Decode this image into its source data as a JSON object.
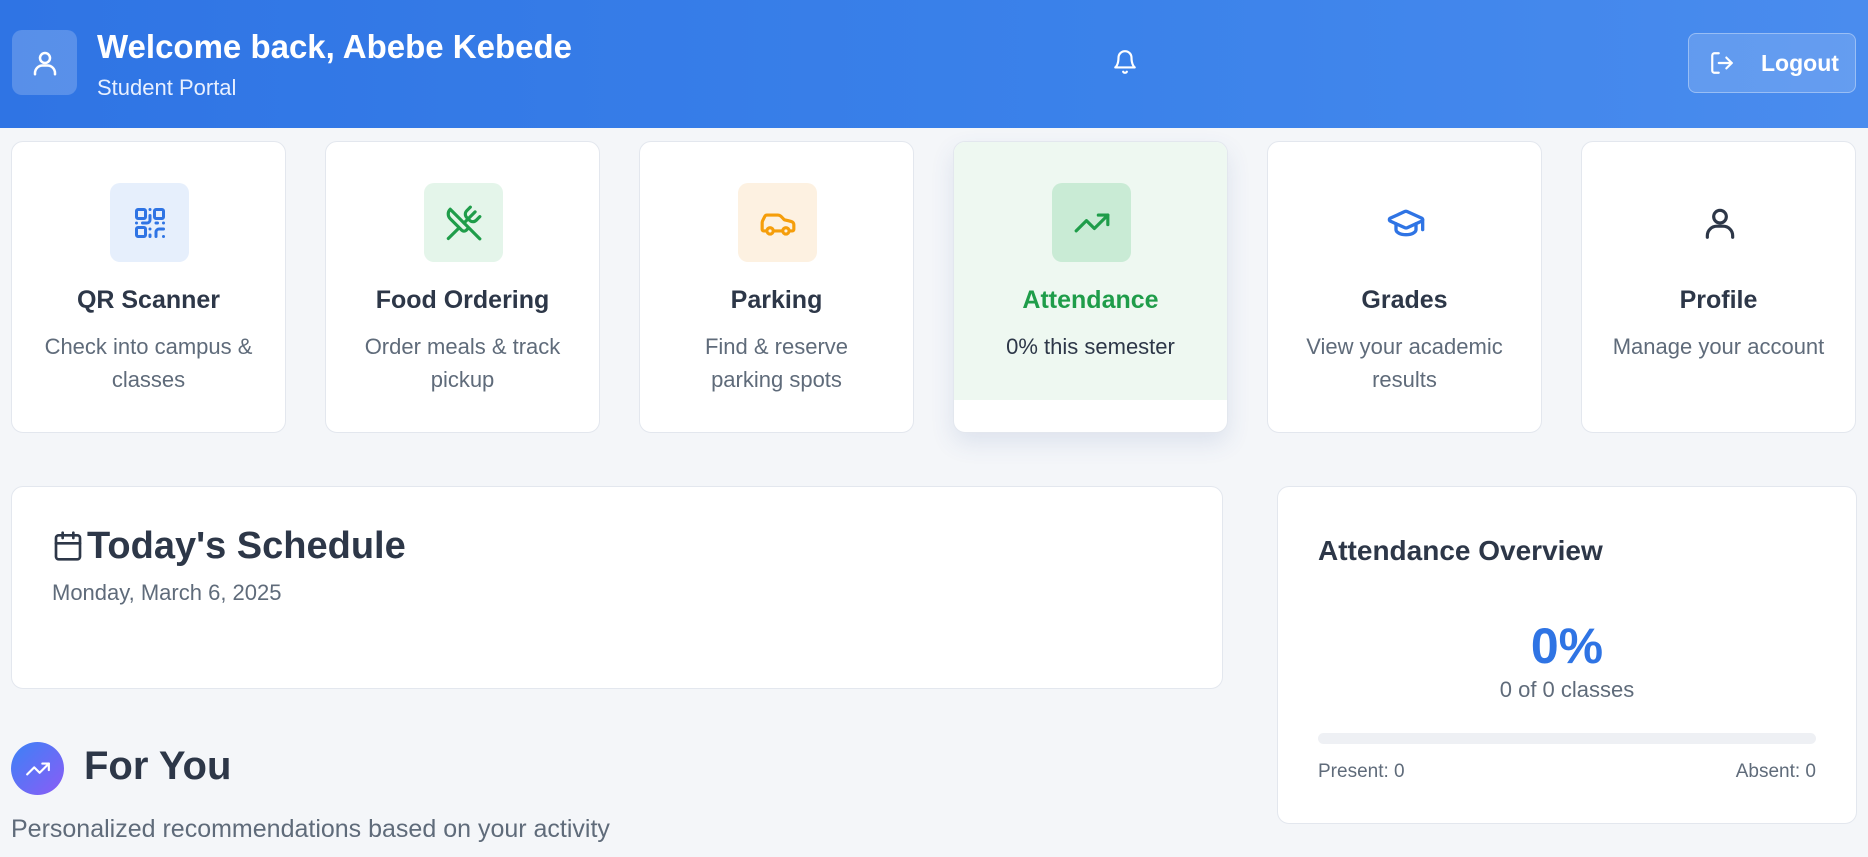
{
  "header": {
    "welcome": "Welcome back, Abebe Kebede",
    "subtitle": "Student Portal",
    "logout_label": "Logout",
    "icons": [
      "user-icon",
      "bell-icon",
      "logout-icon"
    ]
  },
  "cards": [
    {
      "title": "QR Scanner",
      "desc": "Check into campus & classes",
      "icon": "qr-code-icon",
      "tile": "#e6effc",
      "color": "#2f74e4"
    },
    {
      "title": "Food Ordering",
      "desc": "Order meals & track pickup",
      "icon": "utensils-icon",
      "tile": "#e4f5ea",
      "color": "#1f9d4a"
    },
    {
      "title": "Parking",
      "desc": "Find & reserve parking spots",
      "icon": "car-icon",
      "tile": "#fdf1e1",
      "color": "#f59e0b"
    },
    {
      "title": "Attendance",
      "desc": "0% this semester",
      "icon": "trending-up-icon",
      "tile": "#c9ebd5",
      "color": "#1f9d4a"
    },
    {
      "title": "Grades",
      "desc": "View your academic results",
      "icon": "graduation-cap-icon",
      "tile": "#ffffff",
      "color": "#2f74e4"
    },
    {
      "title": "Profile",
      "desc": "Manage your account",
      "icon": "user-icon",
      "tile": "#ffffff",
      "color": "#2d3748"
    }
  ],
  "schedule": {
    "title": "Today's Schedule",
    "date": "Monday, March 6, 2025"
  },
  "for_you": {
    "title": "For You",
    "subtitle": "Personalized recommendations based on your activity"
  },
  "attendance": {
    "title": "Attendance Overview",
    "percent": "0%",
    "classes": "0 of 0 classes",
    "present": "Present: 0",
    "absent": "Absent: 0",
    "progress": 0
  }
}
